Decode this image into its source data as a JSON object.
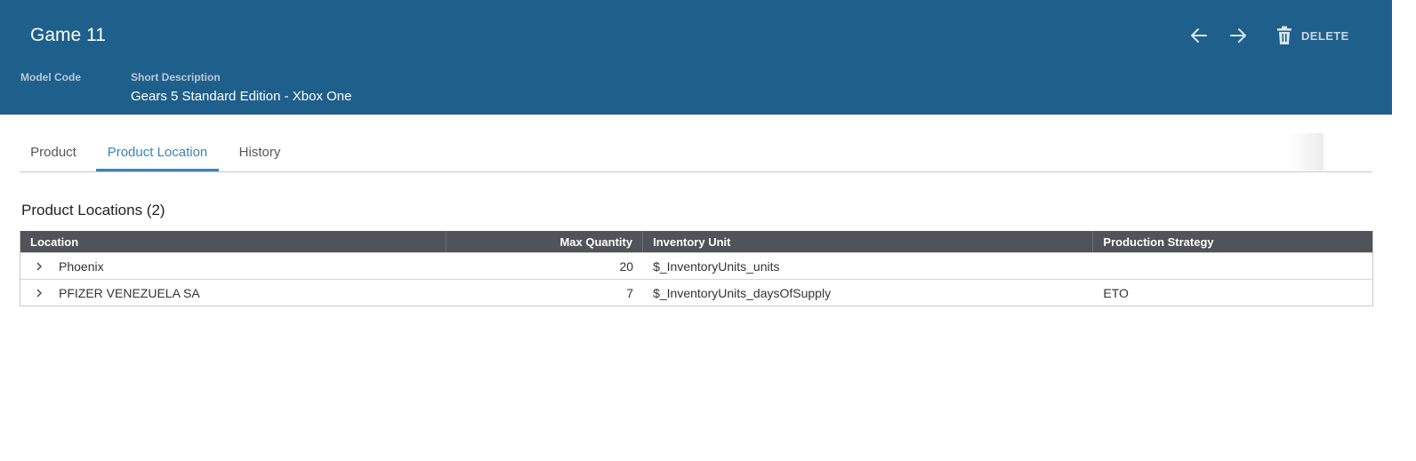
{
  "header": {
    "title": "Game 11",
    "model_code_label": "Model Code",
    "short_description_label": "Short Description",
    "short_description_value": "Gears 5 Standard Edition - Xbox One",
    "delete_label": "DELETE"
  },
  "tabs": [
    {
      "label": "Product"
    },
    {
      "label": "Product Location"
    },
    {
      "label": "History"
    }
  ],
  "active_tab": "Product Location",
  "section": {
    "title": "Product Locations (2)"
  },
  "table": {
    "columns": [
      "Location",
      "Max Quantity",
      "Inventory Unit",
      "Production Strategy"
    ],
    "rows": [
      {
        "location": "Phoenix",
        "max_quantity": "20",
        "inventory_unit": "$_InventoryUnits_units",
        "production_strategy": ""
      },
      {
        "location": "PFIZER VENEZUELA SA",
        "max_quantity": "7",
        "inventory_unit": "$_InventoryUnits_daysOfSupply",
        "production_strategy": "ETO"
      }
    ]
  },
  "colors": {
    "header_bg": "#1f5f8b",
    "accent": "#3a84b8",
    "grid_header_bg": "#505359"
  },
  "icons": [
    "arrow-left-icon",
    "arrow-right-icon",
    "trash-icon",
    "chevron-right-icon"
  ]
}
